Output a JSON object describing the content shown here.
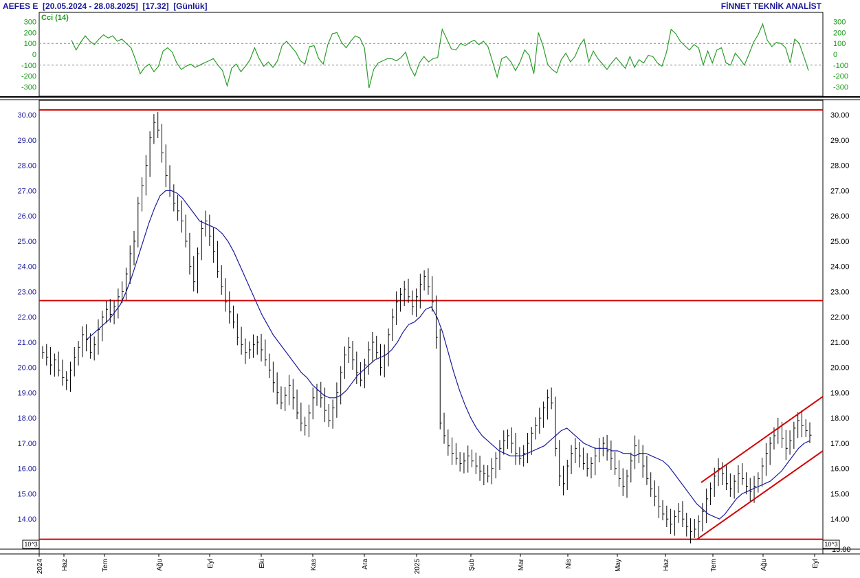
{
  "header": {
    "ticker": "AEFES E",
    "date_range": "[20.05.2024 - 28.08.2025]",
    "last_price": "[17.32]",
    "period": "[Günlük]",
    "brand": "FİNNET TEKNİK ANALİST"
  },
  "indicator": {
    "label": "Cci (14)",
    "y_ticks": [
      300,
      200,
      100,
      0,
      -100,
      -200,
      -300
    ],
    "y_tick_labels": [
      "300",
      "200",
      "100",
      "0",
      "-100",
      "-200",
      "-300"
    ],
    "reference_levels": [
      100,
      -100
    ],
    "color": "#2a9d2a"
  },
  "scale_note": "10^3",
  "chart_data": {
    "type": "line",
    "title": "AEFES E",
    "price_axis": {
      "ylim": [
        13.0,
        30.25
      ],
      "ticks": [
        14,
        15,
        16,
        17,
        18,
        19,
        20,
        21,
        22,
        23,
        24,
        25,
        26,
        27,
        28,
        29,
        30
      ],
      "tick_labels": [
        "14.00",
        "15.00",
        "16.00",
        "17.00",
        "18.00",
        "19.00",
        "20.00",
        "21.00",
        "22.00",
        "23.00",
        "24.00",
        "25.00",
        "26.00",
        "27.00",
        "28.00",
        "29.00",
        "30.00"
      ],
      "bottom_label": "13.00"
    },
    "x_axis": {
      "labels": [
        "2024",
        "Haz",
        "Tem",
        "Ağu",
        "Eyl",
        "Eki",
        "Kas",
        "Ara",
        "2025",
        "Şub",
        "Mar",
        "Nis",
        "May",
        "Haz",
        "Tem",
        "Ağu",
        "Eyl"
      ]
    },
    "horizontal_lines": [
      30.2,
      22.65,
      13.2
    ],
    "channel": {
      "upper": {
        "from": [
          "Tem 2025",
          15.45
        ],
        "to": [
          "Eyl 2025",
          18.85
        ]
      },
      "lower": {
        "from": [
          "Tem 2025",
          13.2
        ],
        "to": [
          "Eyl 2025",
          16.7
        ]
      }
    },
    "series": [
      {
        "name": "Price",
        "color": "#000000",
        "style": "ohlc-bars",
        "values": [
          20.6,
          20.4,
          20.1,
          20.3,
          19.9,
          19.6,
          19.5,
          19.9,
          20.4,
          20.8,
          21.3,
          21.1,
          20.6,
          20.9,
          21.5,
          22.0,
          22.3,
          22.1,
          22.4,
          22.8,
          23.0,
          23.7,
          24.5,
          25.0,
          26.5,
          27.2,
          28.0,
          29.1,
          29.7,
          29.4,
          28.5,
          27.6,
          27.0,
          26.5,
          26.2,
          25.8,
          25.0,
          24.0,
          23.4,
          24.5,
          25.5,
          25.8,
          25.2,
          24.6,
          23.8,
          23.2,
          22.6,
          22.2,
          21.8,
          21.2,
          20.9,
          20.6,
          20.7,
          20.9,
          21.0,
          20.7,
          20.3,
          19.9,
          19.4,
          19.0,
          18.6,
          18.9,
          19.3,
          18.8,
          18.2,
          17.8,
          17.7,
          18.2,
          18.8,
          19.1,
          18.8,
          18.3,
          17.9,
          18.4,
          19.0,
          19.8,
          20.5,
          20.8,
          20.3,
          19.8,
          19.5,
          20.1,
          20.7,
          21.0,
          20.6,
          20.0,
          20.5,
          21.3,
          22.0,
          22.6,
          22.9,
          23.1,
          22.8,
          22.4,
          22.8,
          23.3,
          23.6,
          23.2,
          22.6,
          21.2,
          17.8,
          17.3,
          16.9,
          16.6,
          16.4,
          16.2,
          16.3,
          16.5,
          16.3,
          16.1,
          15.9,
          15.8,
          15.7,
          16.0,
          16.4,
          16.8,
          17.1,
          17.3,
          17.0,
          16.6,
          16.4,
          16.6,
          17.0,
          17.4,
          17.7,
          18.0,
          18.4,
          18.8,
          18.6,
          16.8,
          15.7,
          15.4,
          16.1,
          16.6,
          16.8,
          16.5,
          16.2,
          16.0,
          16.2,
          16.5,
          16.8,
          17.0,
          16.7,
          16.4,
          16.0,
          15.6,
          15.3,
          15.7,
          16.3,
          16.9,
          16.6,
          16.1,
          15.6,
          15.2,
          14.9,
          14.5,
          14.2,
          14.0,
          13.8,
          14.1,
          14.3,
          14.0,
          13.7,
          13.5,
          13.6,
          13.9,
          14.3,
          14.8,
          15.2,
          15.7,
          16.0,
          15.8,
          15.4,
          15.2,
          15.5,
          15.8,
          15.6,
          15.3,
          15.1,
          15.3,
          15.6,
          16.1,
          16.6,
          17.0,
          17.3,
          17.6,
          17.2,
          16.8,
          17.1,
          17.6,
          17.9,
          17.7,
          17.5,
          17.32
        ]
      },
      {
        "name": "Moving average",
        "color": "#1a1a9a",
        "style": "line",
        "values": [
          21.1,
          21.3,
          21.5,
          21.7,
          21.9,
          22.2,
          22.5,
          23.0,
          23.6,
          24.3,
          25.0,
          25.7,
          26.3,
          26.8,
          27.0,
          27.0,
          26.9,
          26.7,
          26.4,
          26.1,
          25.8,
          25.7,
          25.6,
          25.5,
          25.3,
          25.0,
          24.6,
          24.1,
          23.6,
          23.1,
          22.6,
          22.1,
          21.7,
          21.3,
          21.0,
          20.7,
          20.4,
          20.1,
          19.8,
          19.6,
          19.3,
          19.1,
          18.9,
          18.8,
          18.8,
          18.9,
          19.1,
          19.4,
          19.7,
          19.9,
          20.1,
          20.3,
          20.4,
          20.5,
          20.7,
          21.0,
          21.4,
          21.7,
          21.8,
          22.0,
          22.3,
          22.4,
          22.0,
          21.4,
          20.6,
          19.8,
          19.1,
          18.5,
          18.0,
          17.6,
          17.3,
          17.1,
          16.9,
          16.7,
          16.6,
          16.5,
          16.5,
          16.5,
          16.6,
          16.7,
          16.8,
          16.9,
          17.1,
          17.3,
          17.5,
          17.6,
          17.4,
          17.2,
          17.0,
          16.9,
          16.8,
          16.8,
          16.8,
          16.7,
          16.7,
          16.6,
          16.6,
          16.5,
          16.6,
          16.6,
          16.5,
          16.4,
          16.3,
          16.1,
          15.8,
          15.5,
          15.2,
          14.9,
          14.6,
          14.4,
          14.2,
          14.1,
          14.0,
          14.2,
          14.5,
          14.8,
          15.0,
          15.1,
          15.2,
          15.3,
          15.4,
          15.5,
          15.7,
          15.9,
          16.2,
          16.5,
          16.8,
          17.0,
          17.1
        ]
      },
      {
        "name": "Cci (14)",
        "color": "#2a9d2a",
        "style": "line",
        "values": [
          130,
          40,
          110,
          170,
          120,
          90,
          140,
          180,
          150,
          170,
          120,
          140,
          100,
          60,
          -50,
          -180,
          -120,
          -90,
          -160,
          -110,
          30,
          60,
          20,
          -80,
          -140,
          -110,
          -90,
          -120,
          -100,
          -80,
          -60,
          -40,
          -100,
          -150,
          -290,
          -130,
          -90,
          -160,
          -110,
          -50,
          60,
          -40,
          -110,
          -70,
          -120,
          -60,
          80,
          120,
          70,
          20,
          -60,
          -90,
          70,
          80,
          -40,
          -90,
          90,
          190,
          200,
          110,
          60,
          120,
          170,
          150,
          60,
          -310,
          -140,
          -80,
          -60,
          -40,
          -40,
          -60,
          -30,
          20,
          -120,
          -200,
          -80,
          -20,
          -70,
          -40,
          -30,
          230,
          140,
          50,
          40,
          100,
          80,
          110,
          130,
          90,
          120,
          70,
          -70,
          -210,
          -40,
          -20,
          -70,
          -150,
          -70,
          40,
          -10,
          -180,
          200,
          80,
          -90,
          -140,
          -170,
          -50,
          10,
          -70,
          -20,
          80,
          140,
          -70,
          30,
          -40,
          -90,
          -140,
          -80,
          -30,
          -80,
          -130,
          -20,
          -120,
          -50,
          -80,
          -10,
          -20,
          -80,
          -110,
          20,
          230,
          190,
          120,
          80,
          40,
          90,
          60,
          -100,
          30,
          -80,
          40,
          60,
          -80,
          -100,
          10,
          -40,
          -100,
          0,
          110,
          180,
          280,
          130,
          70,
          110,
          100,
          60,
          -80,
          140,
          100,
          -20,
          -150
        ]
      }
    ]
  }
}
